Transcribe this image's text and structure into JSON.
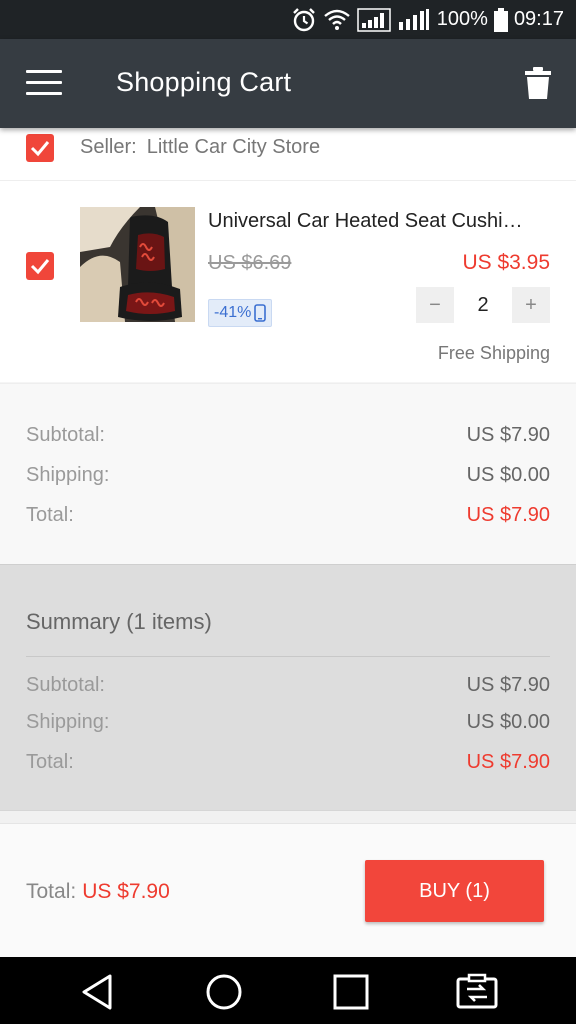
{
  "status_bar": {
    "battery": "100%",
    "time": "09:17",
    "icons": [
      "alarm-icon",
      "wifi-icon",
      "signal-icon",
      "signal-icon",
      "battery-icon"
    ]
  },
  "app_bar": {
    "title": "Shopping Cart",
    "menu_icon": "menu-icon",
    "delete_icon": "trash-icon"
  },
  "seller": {
    "label": "Seller:",
    "name": "Little Car City Store",
    "checked": true
  },
  "product": {
    "title": "Universal Car Heated Seat Cushi…",
    "old_price": "US $6.69",
    "price": "US $3.95",
    "discount": "-41%",
    "discount_icon": "mobile-icon",
    "quantity": "2",
    "qty_minus": "−",
    "qty_plus": "+",
    "shipping_note": "Free Shipping",
    "checked": true
  },
  "store_totals": {
    "subtotal_label": "Subtotal:",
    "subtotal_value": "US $7.90",
    "shipping_label": "Shipping:",
    "shipping_value": "US $0.00",
    "total_label": "Total:",
    "total_value": "US $7.90"
  },
  "summary": {
    "title": "Summary (1 items)",
    "subtotal_label": "Subtotal:",
    "subtotal_value": "US $7.90",
    "shipping_label": "Shipping:",
    "shipping_value": "US $0.00",
    "total_label": "Total:",
    "total_value": "US $7.90"
  },
  "bottom_bar": {
    "total_label": "Total:",
    "total_value": "US $7.90",
    "buy_label": "BUY (1)"
  },
  "nav_bar": {
    "buttons": [
      "back-icon",
      "home-icon",
      "recents-icon",
      "screen-share-icon"
    ]
  },
  "colors": {
    "accent": "#f2463b",
    "app_bar": "#363c42",
    "price_red": "#ee3b2f"
  }
}
